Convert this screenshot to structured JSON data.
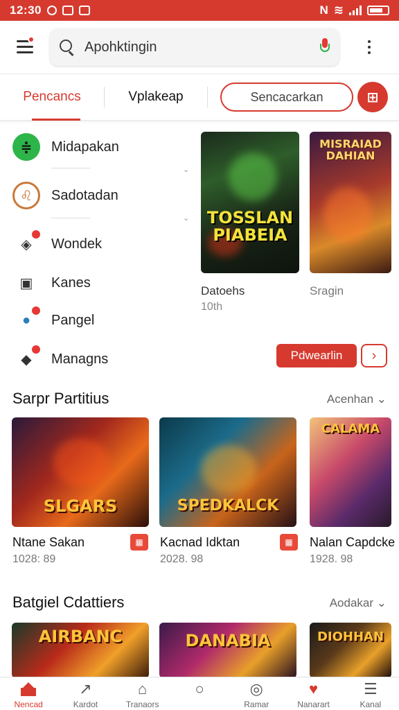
{
  "status_bar": {
    "time": "12:30",
    "right_text": "N",
    "icons": [
      "circle-icon",
      "notification-icon",
      "photo-icon",
      "wifi-icon",
      "signal-icon",
      "battery-icon"
    ]
  },
  "header": {
    "search_value": "Apohktingin",
    "menu_badge_color": "#e53935"
  },
  "tabs": {
    "tab_1": "Pencancs",
    "tab_2": "Vplakeap",
    "chip": "Sencacarkan",
    "chip_button_icon": "filter-icon"
  },
  "menu": {
    "items": [
      {
        "label": "Midapakan",
        "icon": "green-badge-icon"
      },
      {
        "label": "Sadotadan",
        "icon": "lion-icon"
      },
      {
        "label": "Wondek",
        "icon": "controller-icon"
      },
      {
        "label": "Kanes",
        "icon": "card-icon"
      },
      {
        "label": "Pangel",
        "icon": "balloons-icon"
      },
      {
        "label": "Managns",
        "icon": "cube-icon"
      }
    ]
  },
  "featured": {
    "cards": [
      {
        "art_title": "TOSSLAN PIABEIA",
        "caption": "Datoehs",
        "sub": "10th"
      },
      {
        "art_title": "MISRAIAD DAHIAN",
        "caption": "Sragin",
        "sub": ""
      }
    ],
    "cta_label": "Pdwearlin",
    "cta_arrow": "›"
  },
  "section_1": {
    "title": "Sarpr Partitius",
    "more": "Acenhan ⌄",
    "games": [
      {
        "art_title": "SLGARS",
        "name": "Ntane Sakan",
        "meta": "1028: 89"
      },
      {
        "art_title": "SPEDKALCK",
        "name": "Kacnad Idktan",
        "meta": "2028. 98"
      },
      {
        "art_title": "CALAMA",
        "name": "Nalan Capdcke",
        "meta": "1928. 98"
      }
    ]
  },
  "section_2": {
    "title": "Batgiel Cdattiers",
    "more": "Aodakar ⌄",
    "games": [
      {
        "art_title": "AIRBANC"
      },
      {
        "art_title": "DANABIA"
      },
      {
        "art_title": "DIOHHAN"
      }
    ]
  },
  "bottom_nav": {
    "items": [
      {
        "label": "Nencad",
        "icon": "home-icon"
      },
      {
        "label": "Kardot",
        "icon": "share-icon"
      },
      {
        "label": "Tranaors",
        "icon": "store-icon"
      },
      {
        "label": "",
        "icon": "search-icon"
      },
      {
        "label": "Ramar",
        "icon": "location-icon"
      },
      {
        "label": "Nanarart",
        "icon": "heart-icon"
      },
      {
        "label": "Kanal",
        "icon": "menu-icon"
      }
    ]
  },
  "accent_color": "#d63a2f"
}
